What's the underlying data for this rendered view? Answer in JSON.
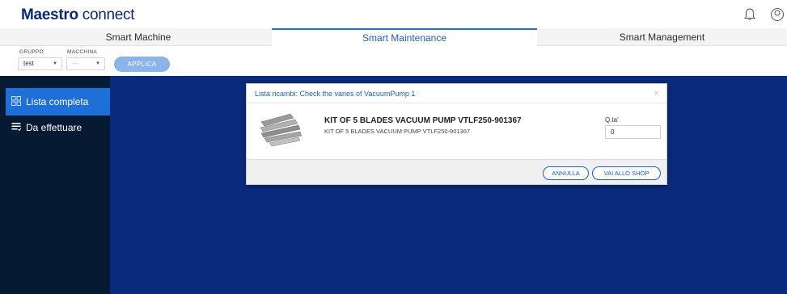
{
  "header": {
    "logo_bold": "Maestro",
    "logo_light": "connect",
    "icons": [
      "bell-icon",
      "user-icon"
    ]
  },
  "tabs": [
    {
      "label": "Smart Machine",
      "active": false
    },
    {
      "label": "Smart Maintenance",
      "active": true
    },
    {
      "label": "Smart Management",
      "active": false
    }
  ],
  "filters": {
    "gruppo_label": "GRUPPO",
    "gruppo_value": "test",
    "macchina_label": "MACCHINA",
    "macchina_value": "---",
    "apply_label": "APPLICA"
  },
  "sidebar": {
    "items": [
      {
        "label": "Lista completa",
        "icon": "grid-icon",
        "active": true
      },
      {
        "label": "Da effettuare",
        "icon": "list-icon",
        "active": false
      }
    ]
  },
  "modal": {
    "title": "Lista ricambi: Check the vanes of VacuumPump 1",
    "close": "×",
    "item_title": "KIT OF 5 BLADES VACUUM PUMP VTLF250-901367",
    "item_desc": "KIT OF 5 BLADES VACUUM PUMP VTLF250-901367",
    "qty_label": "Q.ta'",
    "qty_value": "0",
    "cancel_label": "ANNULLA",
    "shop_label": "VAI ALLO SHOP"
  },
  "colors": {
    "brand": "#0b2a6f",
    "accent": "#1f6fd6",
    "sidebar_bg": "#071a33",
    "main_bg": "#0a2a7e"
  }
}
